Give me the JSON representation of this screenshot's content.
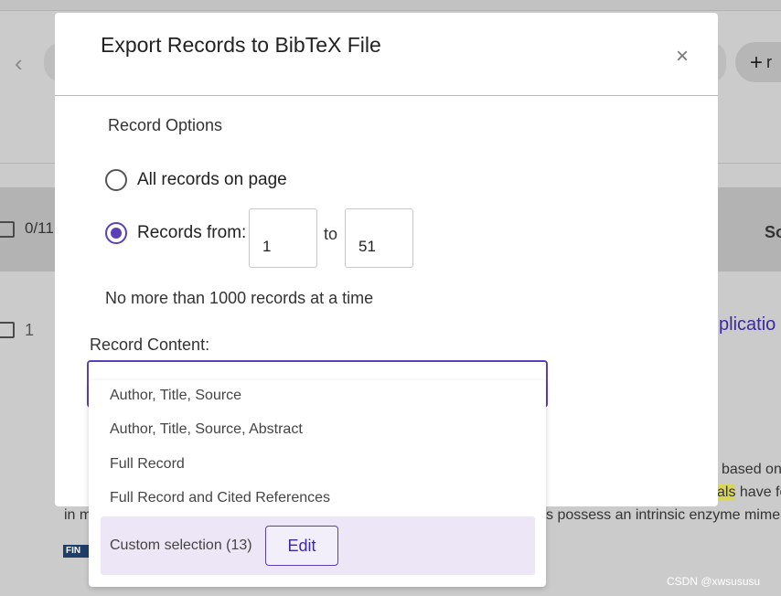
{
  "background": {
    "back_glyph": "‹",
    "add_glyph": "+",
    "add_label": "r",
    "selected_count": "0/11",
    "column_header": "So",
    "row_number": "1",
    "row_title_fragment": "plicatio",
    "abstract_line1": "based on",
    "abstract_line2_hl": "als",
    "abstract_line2": " have fo",
    "abstract_line3_left": "in m",
    "abstract_line3_right": "s possess an intrinsic enzyme mime",
    "logo_text": "FIN"
  },
  "modal": {
    "title": "Export Records to BibTeX File",
    "close_glyph": "×",
    "record_options_label": "Record Options",
    "all_records_label": "All records on page",
    "records_from_label": "Records from:",
    "from_value": "1",
    "to_label": "to",
    "to_value": "51",
    "limit_note": "No more than 1000 records at a time",
    "record_content_label": "Record Content:"
  },
  "dropdown": {
    "options": [
      "Author, Title, Source",
      "Author, Title, Source, Abstract",
      "Full Record",
      "Full Record and Cited References"
    ],
    "selected_option": "Custom selection (13)",
    "edit_label": "Edit"
  },
  "watermark": "CSDN @xwsususu",
  "colors": {
    "accent": "#5b3fb8",
    "selected_bg": "#ece6f6",
    "overlay": "#cbcbcb"
  }
}
